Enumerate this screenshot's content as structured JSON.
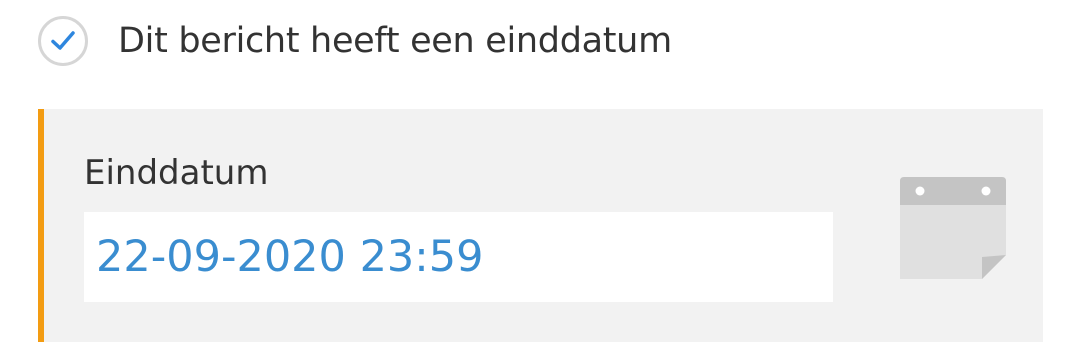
{
  "checkbox": {
    "label": "Dit bericht heeft een einddatum",
    "checked": true,
    "check_color": "#2e86de",
    "border_color": "#d6d6d6"
  },
  "end_date": {
    "label": "Einddatum",
    "value": "22-09-2020 23:59",
    "value_color": "#3a8dd0",
    "accent_color": "#f39c12",
    "panel_bg": "#f2f2f2"
  },
  "calendar_button": {
    "icon": "calendar-icon"
  }
}
